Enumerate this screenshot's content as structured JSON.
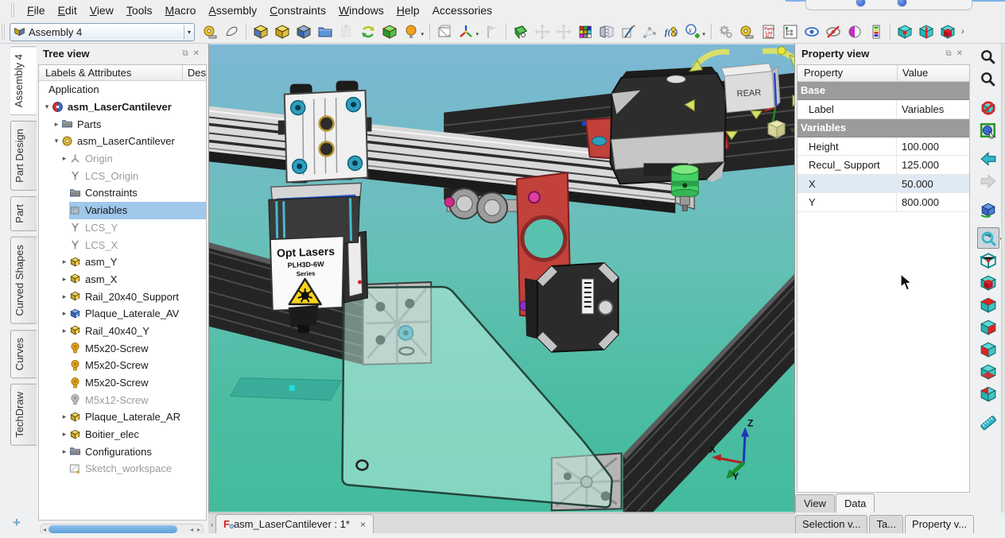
{
  "menu": {
    "items": [
      {
        "label": "File",
        "accel": "F"
      },
      {
        "label": "Edit",
        "accel": "E"
      },
      {
        "label": "View",
        "accel": "V"
      },
      {
        "label": "Tools",
        "accel": "T"
      },
      {
        "label": "Macro",
        "accel": "M"
      },
      {
        "label": "Assembly",
        "accel": "A"
      },
      {
        "label": "Constraints",
        "accel": "C"
      },
      {
        "label": "Windows",
        "accel": "W"
      },
      {
        "label": "Help",
        "accel": "H"
      },
      {
        "label": "Accessories",
        "accel": ""
      }
    ]
  },
  "toolbar": {
    "workbench_selector": "Assembly 4",
    "dropdown_glyph": "▾",
    "overflow_glyph": "›",
    "buttons": [
      {
        "name": "measure-tool",
        "t": "tape",
        "a": "#e8c63a"
      },
      {
        "name": "sketch-tool",
        "t": "sketchpad",
        "a": "#f2f2f2"
      },
      {
        "sep": true
      },
      {
        "name": "insert-part",
        "t": "cube",
        "a": "#f2dc66",
        "b": "#4a78c0",
        "c": "#d8b840"
      },
      {
        "name": "new-part",
        "t": "cube",
        "a": "#f2dc66",
        "b": "#c8a020",
        "c": "#e2c24a"
      },
      {
        "name": "new-body",
        "t": "cube",
        "a": "#8ab2e4",
        "b": "#3a68b0",
        "c": "#5a88d0"
      },
      {
        "name": "open-document",
        "t": "folder",
        "a": "#5f93d8"
      },
      {
        "name": "paste-ghost",
        "t": "paste",
        "a": "#bbbbbb",
        "dis": true
      },
      {
        "name": "swap-link",
        "t": "swap"
      },
      {
        "name": "import-part",
        "t": "cube",
        "a": "#8ae070",
        "b": "#2a9a30",
        "c": "#4ec24a"
      },
      {
        "name": "show-attachment",
        "t": "bulb",
        "a": "#f0a020",
        "dd": true
      },
      {
        "sep": true
      },
      {
        "name": "new-body-box",
        "t": "box",
        "a": "#d8d8d8"
      },
      {
        "name": "new-lcs",
        "t": "axis",
        "dd": true
      },
      {
        "name": "placement-flag",
        "t": "flag",
        "a": "#b0b0b0",
        "dis": true
      },
      {
        "sep": true
      },
      {
        "name": "release-attachment",
        "t": "face",
        "a": "#5dc85d"
      },
      {
        "name": "move-part",
        "t": "move",
        "a": "#b0b0b0",
        "dis": true
      },
      {
        "name": "translate-part",
        "t": "move",
        "a": "#b0b0b0",
        "dis": true
      },
      {
        "name": "solver-rubik",
        "t": "rubik"
      },
      {
        "name": "mirror-part",
        "t": "mirror",
        "a": "#b8c4d0"
      },
      {
        "name": "edit-sketch-placement",
        "t": "sketch2",
        "a": "#98a8b8"
      },
      {
        "name": "symmetry-array",
        "t": "net",
        "a": "#98a8b8"
      },
      {
        "name": "expression-fx",
        "t": "fx",
        "a": "#2a4a9a"
      },
      {
        "name": "add-variable",
        "t": "addvar",
        "dd": true
      },
      {
        "sep": true
      },
      {
        "name": "config-gears",
        "t": "gear",
        "a": "#a8a8a8"
      },
      {
        "name": "measure-assembly",
        "t": "tape",
        "a": "#e8c63a"
      },
      {
        "name": "parts-list",
        "t": "list",
        "a": "#c03030"
      },
      {
        "name": "tree-options",
        "t": "tree",
        "a": "#3a7a3a"
      },
      {
        "name": "show-selected",
        "t": "eye",
        "a": "#3a6ad0"
      },
      {
        "name": "hide-selected",
        "t": "eyex",
        "a": "#8a8a8a"
      },
      {
        "name": "appearance",
        "t": "half",
        "a": "#c030c0"
      },
      {
        "name": "color-legend",
        "t": "bars"
      },
      {
        "sep": true
      },
      {
        "name": "vertex-display",
        "t": "vcube",
        "v": "dot"
      },
      {
        "name": "edge-display",
        "t": "vcube",
        "v": "bar"
      },
      {
        "name": "face-display",
        "t": "vcube",
        "v": "solid"
      }
    ]
  },
  "workbench_tabs": {
    "items": [
      {
        "label": "Assembly 4",
        "active": true
      },
      {
        "label": "Part Design",
        "active": false
      },
      {
        "label": "Part",
        "active": false
      },
      {
        "label": "Curved Shapes",
        "active": false
      },
      {
        "label": "Curves",
        "active": false
      },
      {
        "label": "TechDraw",
        "active": false
      }
    ],
    "add_button": "+"
  },
  "tree_panel": {
    "title": "Tree view",
    "float_glyph": "⧉",
    "close_glyph": "✕",
    "columns": [
      "Labels & Attributes",
      "Des"
    ],
    "items": [
      {
        "label": "Application",
        "lvl": 0,
        "caret": "",
        "icon": "",
        "state": "normal"
      },
      {
        "label": "asm_LaserCantilever",
        "lvl": 1,
        "caret": "▾",
        "icon": "doc",
        "state": "bold"
      },
      {
        "label": "Parts",
        "lvl": 2,
        "caret": "▸",
        "icon": "folder",
        "state": "normal"
      },
      {
        "label": "asm_LaserCantilever",
        "lvl": 2,
        "caret": "▾",
        "icon": "model",
        "state": "normal"
      },
      {
        "label": "Origin",
        "lvl": 3,
        "caret": "▸",
        "icon": "origin",
        "state": "gray"
      },
      {
        "label": "LCS_Origin",
        "lvl": 3,
        "caret": "",
        "icon": "lcs",
        "state": "gray"
      },
      {
        "label": "Constraints",
        "lvl": 3,
        "caret": "",
        "icon": "folder",
        "state": "normal"
      },
      {
        "label": "Variables",
        "lvl": 3,
        "caret": "",
        "icon": "varbox",
        "state": "sel"
      },
      {
        "label": "LCS_Y",
        "lvl": 3,
        "caret": "",
        "icon": "lcs",
        "state": "gray"
      },
      {
        "label": "LCS_X",
        "lvl": 3,
        "caret": "",
        "icon": "lcs",
        "state": "gray"
      },
      {
        "label": "asm_Y",
        "lvl": 3,
        "caret": "▸",
        "icon": "linky",
        "state": "normal"
      },
      {
        "label": "asm_X",
        "lvl": 3,
        "caret": "▸",
        "icon": "linky",
        "state": "normal"
      },
      {
        "label": "Rail_20x40_Support",
        "lvl": 3,
        "caret": "▸",
        "icon": "linky",
        "state": "normal"
      },
      {
        "label": "Plaque_Laterale_AV",
        "lvl": 3,
        "caret": "▸",
        "icon": "linkb",
        "state": "normal"
      },
      {
        "label": "Rail_40x40_Y",
        "lvl": 3,
        "caret": "▸",
        "icon": "linky",
        "state": "normal"
      },
      {
        "label": "M5x20-Screw",
        "lvl": 3,
        "caret": "",
        "icon": "screwy",
        "state": "normal"
      },
      {
        "label": "M5x20-Screw",
        "lvl": 3,
        "caret": "",
        "icon": "screwy",
        "state": "normal"
      },
      {
        "label": "M5x20-Screw",
        "lvl": 3,
        "caret": "",
        "icon": "screwy",
        "state": "normal"
      },
      {
        "label": "M5x12-Screw",
        "lvl": 3,
        "caret": "",
        "icon": "screwg",
        "state": "gray"
      },
      {
        "label": "Plaque_Laterale_AR",
        "lvl": 3,
        "caret": "▸",
        "icon": "linky",
        "state": "normal"
      },
      {
        "label": "Boitier_elec",
        "lvl": 3,
        "caret": "▸",
        "icon": "linky",
        "state": "normal"
      },
      {
        "label": "Configurations",
        "lvl": 3,
        "caret": "▸",
        "icon": "folder",
        "state": "normal"
      },
      {
        "label": "Sketch_workspace",
        "lvl": 3,
        "caret": "",
        "icon": "sketchws",
        "state": "gray"
      }
    ]
  },
  "property_panel": {
    "title": "Property view",
    "float_glyph": "⧉",
    "close_glyph": "✕",
    "columns": [
      "Property",
      "Value"
    ],
    "groups": [
      {
        "name": "Base",
        "rows": [
          {
            "property": "Label",
            "value": "Variables",
            "hl": false
          }
        ]
      },
      {
        "name": "Variables",
        "rows": [
          {
            "property": "Height",
            "value": "100.000",
            "hl": false
          },
          {
            "property": "Recul_ Support",
            "value": "125.000",
            "hl": false
          },
          {
            "property": "X",
            "value": "50.000",
            "hl": true
          },
          {
            "property": "Y",
            "value": "800.000",
            "hl": false
          }
        ]
      }
    ],
    "view_data_tabs": [
      {
        "label": "View",
        "active": false
      },
      {
        "label": "Data",
        "active": true
      }
    ]
  },
  "stacked_panel_tabs": [
    {
      "label": "Selection v...",
      "active": false
    },
    {
      "label": "Ta...",
      "active": false
    },
    {
      "label": "Property v...",
      "active": true
    }
  ],
  "document_tab": {
    "label": "asm_LaserCantilever : 1*",
    "close_glyph": "×",
    "overflow_glyph": "›"
  },
  "right_toolbar": {
    "buttons": [
      {
        "name": "search-zoom",
        "t": "mag",
        "a": "#222222"
      },
      {
        "name": "whats-this",
        "t": "mag",
        "a": "#222222"
      },
      {
        "gap": true
      },
      {
        "name": "clipping-plane",
        "t": "clip",
        "dd": true
      },
      {
        "name": "box-element-selection",
        "t": "selcube"
      },
      {
        "gap": true
      },
      {
        "name": "nav-back",
        "t": "arrowl",
        "a": "#35b8c8"
      },
      {
        "name": "nav-forward",
        "t": "arrowr",
        "a": "#b8b8b8",
        "dis": true
      },
      {
        "gap": true
      },
      {
        "name": "isometric-view",
        "t": "iso",
        "dd": true
      },
      {
        "gap": true
      },
      {
        "name": "fit-all",
        "t": "fit",
        "dd": true,
        "sel": true
      },
      {
        "name": "view-axonometric",
        "t": "wcube"
      },
      {
        "name": "view-front",
        "t": "vcube",
        "v": "solid"
      },
      {
        "name": "view-top",
        "t": "vcube",
        "v": "top"
      },
      {
        "name": "view-right",
        "t": "vcube",
        "v": "right"
      },
      {
        "name": "view-rear",
        "t": "vcube",
        "v": "rear"
      },
      {
        "name": "view-bottom",
        "t": "vcube",
        "v": "bottom"
      },
      {
        "name": "view-left",
        "t": "vcube",
        "v": "left"
      },
      {
        "gap": true
      },
      {
        "name": "measure-distance",
        "t": "ruler",
        "a": "#35b8c8"
      }
    ]
  },
  "viewport": {
    "nav_cube_label": "REAR",
    "axis_labels": {
      "x": "X",
      "y": "Y",
      "z": "Z"
    },
    "laser_label": {
      "line1": "Opt Lasers",
      "line2": "PLH3D-6W",
      "line3": "Series"
    },
    "colors": {
      "bg_top": "#7db7d5",
      "bg_bottom": "#43bb9e",
      "rail_black": "#242424",
      "rail_silver": "#d9d9d9",
      "plate_red": "#c2413a",
      "coupler_green": "#45d065",
      "plate_glass": "#bce8da",
      "accent_teal": "#2f9fbe"
    }
  }
}
